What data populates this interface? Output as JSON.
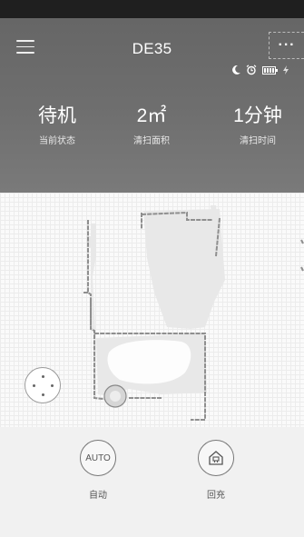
{
  "header": {
    "device_name": "DE35",
    "more_label": "···",
    "stats": [
      {
        "value": "待机",
        "label": "当前状态"
      },
      {
        "value": "2㎡",
        "label": "清扫面积"
      },
      {
        "value": "1分钟",
        "label": "清扫时间"
      }
    ],
    "status_icons": [
      "moon-icon",
      "alarm-clock-icon",
      "battery-icon",
      "charging-icon"
    ]
  },
  "controls": {
    "auto_icon_text": "AUTO",
    "auto_label": "自动",
    "dock_label": "回充"
  },
  "colors": {
    "header_bg": "#6b6b6b",
    "map_grid": "#ececec",
    "map_wall": "#9a9a9a",
    "map_floor": "#e6e6e6"
  }
}
